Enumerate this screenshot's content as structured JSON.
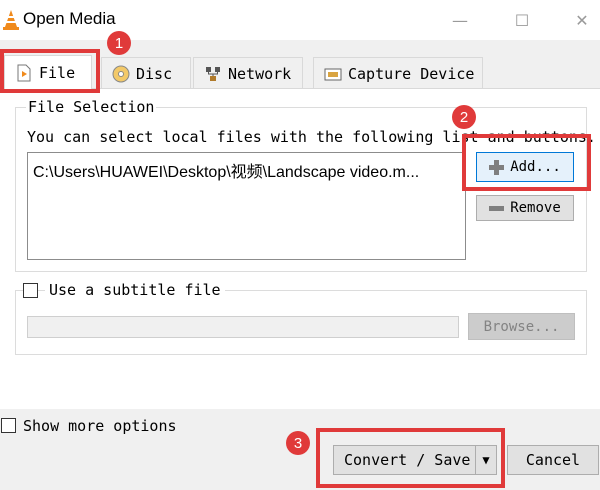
{
  "window": {
    "title": "Open Media",
    "controls": {
      "minimize": "—",
      "maximize": "☐",
      "close": "✕"
    }
  },
  "tabs": [
    {
      "label": "File",
      "icon": "file-icon",
      "active": true
    },
    {
      "label": "Disc",
      "icon": "disc-icon",
      "active": false
    },
    {
      "label": "Network",
      "icon": "network-icon",
      "active": false
    },
    {
      "label": "Capture Device",
      "icon": "capture-device-icon",
      "active": false
    }
  ],
  "file_selection": {
    "group_label": "File Selection",
    "description": "You can select local files with the following list and buttons.",
    "files": [
      "C:\\Users\\HUAWEI\\Desktop\\视频\\Landscape video.m..."
    ],
    "add_label": "Add...",
    "remove_label": "Remove"
  },
  "subtitle": {
    "checkbox_label": "Use a subtitle file",
    "checked": false,
    "path_value": "",
    "browse_label": "Browse..."
  },
  "options": {
    "show_more_label": "Show more options",
    "checked": false
  },
  "actions": {
    "convert_label": "Convert / Save",
    "cancel_label": "Cancel"
  },
  "annotations": {
    "badge_1": "1",
    "badge_2": "2",
    "badge_3": "3",
    "highlight_color": "#e03a3a"
  }
}
